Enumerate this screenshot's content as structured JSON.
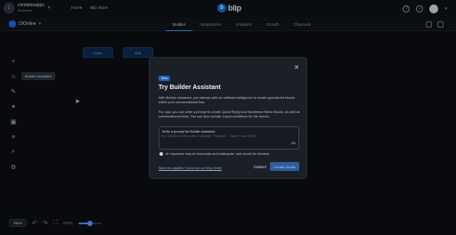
{
  "topbar": {
    "workspace_initial": "c",
    "workspace_name": "contatosapps",
    "workspace_sub": "Business",
    "nav": [
      "Home",
      "Blip Store"
    ],
    "logo_text": "blip",
    "help_icon": "help-icon",
    "notifications_icon": "bell-icon"
  },
  "subbar": {
    "bot_name": "DIOnline",
    "tabs": [
      {
        "label": "Builder",
        "active": true
      },
      {
        "label": "Integrations",
        "active": false
      },
      {
        "label": "Analytics",
        "active": false
      },
      {
        "label": "Growth",
        "active": false
      },
      {
        "label": "Channels",
        "active": false
      }
    ]
  },
  "canvas": {
    "blocks": [
      "Início",
      "Exit"
    ],
    "tooltip": "Builder Assistant"
  },
  "bottom": {
    "save_label": "Save",
    "zoom_label": "100%",
    "zoom_level": 0.5
  },
  "modal": {
    "beta_badge": "Beta",
    "title": "Try Builder Assistant",
    "desc1": "With Builder Assistant, you interact with an artificial intelligence to create specialized blocks within your conversational flow.",
    "desc2": "For now, you can write a prompt to create Quick Reply and Numbered Menu blocks, as well as conversational texts. You can also include output conditions for the blocks.",
    "prompt_label": "Write a prompt for Builder Assistant",
    "prompt_placeholder": "Ex: Create a menu with 3 options: \"Support\", \"Sales\" and \"FAQ\"",
    "prompt_count": "0/0",
    "checkbox_text": "AI responses may be inaccurate and inadequate, and should be checked.",
    "footer_link": "Want new updates? Check out our Help Center",
    "cancel_label": "Cancel",
    "create_label": "Create blocks"
  },
  "colors": {
    "accent": "#1a6ee6",
    "modal_bg": "#1b2027",
    "page_bg": "#0b0e12"
  }
}
